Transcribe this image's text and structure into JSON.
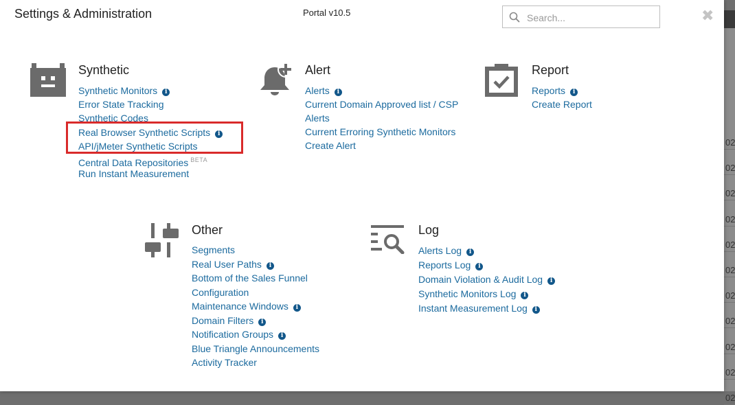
{
  "background": {
    "right_cells": [
      "02",
      "02",
      "02",
      "02",
      "02",
      "02",
      "02",
      "02",
      "02",
      "02",
      "02"
    ]
  },
  "modal": {
    "title": "Settings & Administration",
    "portal_version": "Portal v10.5",
    "search_placeholder": "Search...",
    "close_glyph": "✖"
  },
  "sections": {
    "synthetic": {
      "title": "Synthetic",
      "items": [
        {
          "label": "Synthetic Monitors",
          "info": true
        },
        {
          "label": "Error State Tracking"
        },
        {
          "label": "Synthetic Codes"
        },
        {
          "label": "Real Browser Synthetic Scripts",
          "info": true
        },
        {
          "label": "API/jMeter Synthetic Scripts"
        },
        {
          "label": "Central Data Repositories",
          "badge": "BETA"
        },
        {
          "label": "Run Instant Measurement"
        }
      ]
    },
    "alert": {
      "title": "Alert",
      "items": [
        {
          "label": "Alerts",
          "info": true
        },
        {
          "label": "Current Domain Approved list / CSP"
        },
        {
          "label": "Alerts"
        },
        {
          "label": "Current Erroring Synthetic Monitors"
        },
        {
          "label": "Create Alert"
        }
      ]
    },
    "report": {
      "title": "Report",
      "items": [
        {
          "label": "Reports",
          "info": true
        },
        {
          "label": "Create Report"
        }
      ]
    },
    "other": {
      "title": "Other",
      "items": [
        {
          "label": "Segments"
        },
        {
          "label": "Real User Paths",
          "info": true
        },
        {
          "label": "Bottom of the Sales Funnel"
        },
        {
          "label": "Configuration"
        },
        {
          "label": "Maintenance Windows",
          "info": true
        },
        {
          "label": "Domain Filters",
          "info": true
        },
        {
          "label": "Notification Groups",
          "info": true
        },
        {
          "label": "Blue Triangle Announcements"
        },
        {
          "label": "Activity Tracker"
        }
      ]
    },
    "log": {
      "title": "Log",
      "items": [
        {
          "label": "Alerts Log",
          "info": true
        },
        {
          "label": "Reports Log",
          "info": true
        },
        {
          "label": "Domain Violation & Audit Log",
          "info": true
        },
        {
          "label": "Synthetic Monitors Log",
          "info": true
        },
        {
          "label": "Instant Measurement Log",
          "info": true
        }
      ]
    }
  },
  "icons": {
    "synthetic": "robot-icon",
    "alert": "bell-plus-icon",
    "report": "clipboard-check-icon",
    "other": "sliders-icon",
    "log": "list-search-icon",
    "info": "info-icon",
    "info_glyph": "i"
  },
  "colors": {
    "link": "#1b6a9e",
    "info": "#12578a",
    "highlight": "#d92a2a",
    "icon": "#6b6b6b"
  }
}
